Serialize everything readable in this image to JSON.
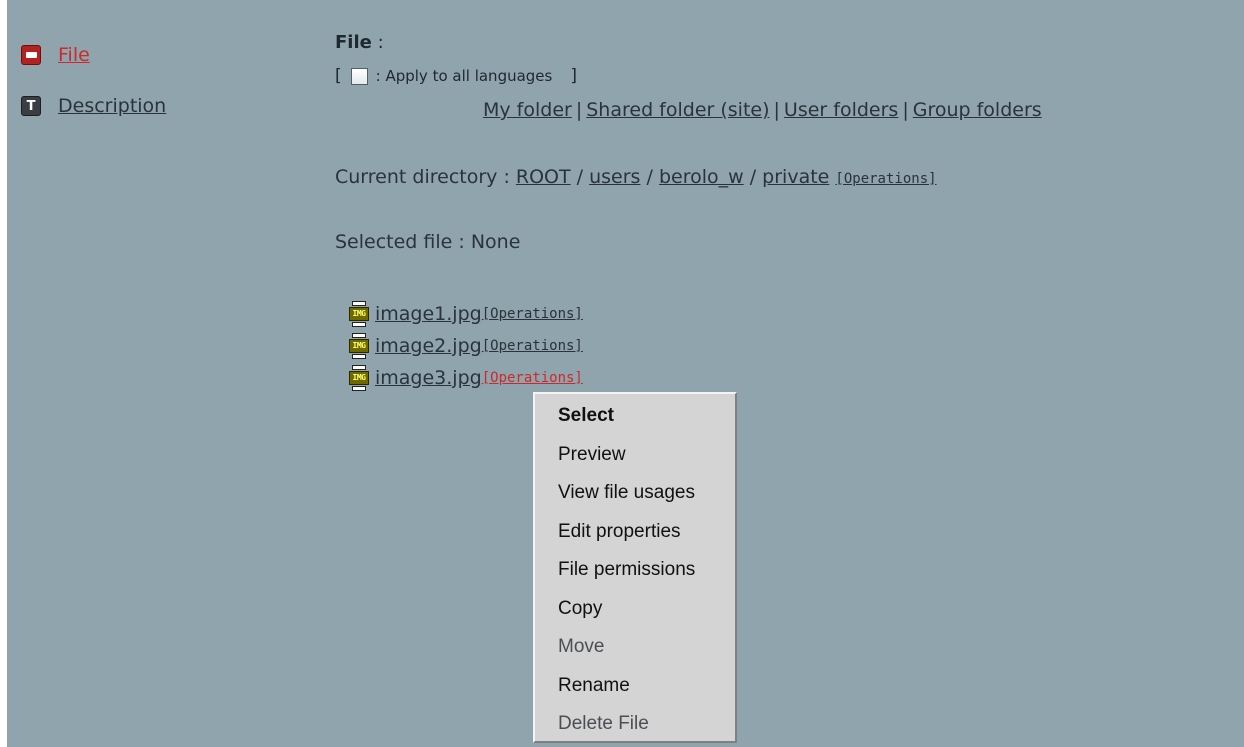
{
  "nav": {
    "items": [
      {
        "label": "File",
        "icon": "file-icon",
        "active": true
      },
      {
        "label": "Description",
        "icon": "text-icon",
        "active": false
      }
    ]
  },
  "main": {
    "title": "File",
    "title_suffix": " :",
    "apply": {
      "open_bracket": "[",
      "label": ": Apply to all languages",
      "close_bracket": "]",
      "checked": false
    },
    "folders": [
      "My folder",
      "Shared folder (site)",
      "User folders",
      "Group folders"
    ],
    "separator": "|",
    "current_dir_label": "Current directory :",
    "path": [
      "ROOT",
      "users",
      "berolo_w",
      "private"
    ],
    "path_separator": "/",
    "operations_label": "[Operations]",
    "selected_label": "Selected file : None",
    "files": [
      {
        "name": "image1.jpg",
        "ops": "[Operations]"
      },
      {
        "name": "image2.jpg",
        "ops": "[Operations]"
      },
      {
        "name": "image3.jpg",
        "ops": "[Operations]"
      }
    ],
    "file_icon_text": "IMG"
  },
  "context_menu": {
    "items": [
      {
        "label": "Select",
        "bold": true,
        "enabled": true
      },
      {
        "label": "Preview",
        "bold": false,
        "enabled": true
      },
      {
        "label": "View file usages",
        "bold": false,
        "enabled": true
      },
      {
        "label": "Edit properties",
        "bold": false,
        "enabled": true
      },
      {
        "label": "File permissions",
        "bold": false,
        "enabled": true
      },
      {
        "label": "Copy",
        "bold": false,
        "enabled": true
      },
      {
        "label": "Move",
        "bold": false,
        "enabled": false
      },
      {
        "label": "Rename",
        "bold": false,
        "enabled": true
      },
      {
        "label": "Delete File",
        "bold": false,
        "enabled": false
      }
    ]
  },
  "colors": {
    "background": "#90a4ad",
    "active_link": "#cc2a2a",
    "menu_background": "#d4d4d4"
  }
}
